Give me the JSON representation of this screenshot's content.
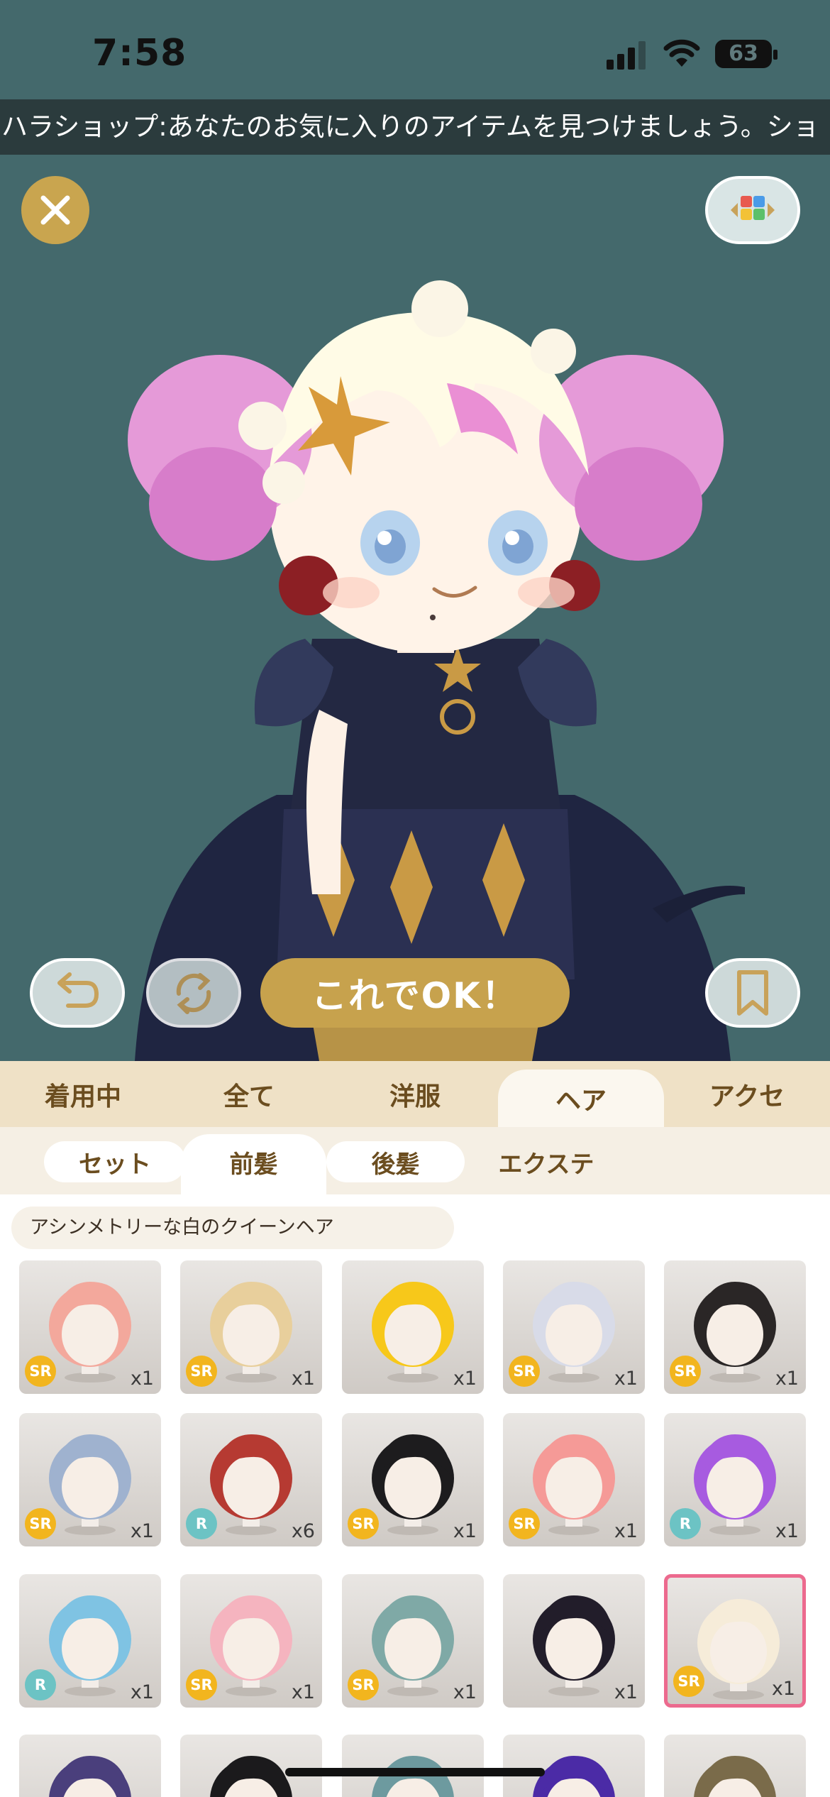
{
  "status": {
    "time": "7:58",
    "battery": "63"
  },
  "ticker": {
    "text": "ハラショップ:あなたのお気に入りのアイテムを見つけましょう。ショ"
  },
  "icons": {
    "close": "close-icon",
    "background": "background-grid-icon",
    "undo": "undo-icon",
    "redo": "redo-icon",
    "bookmark": "bookmark-icon"
  },
  "actions": {
    "ok_label": "これでOK！"
  },
  "category_tabs": [
    {
      "label": "着用中"
    },
    {
      "label": "全て"
    },
    {
      "label": "洋服"
    },
    {
      "label": "ヘア",
      "active": true
    },
    {
      "label": "アクセ"
    }
  ],
  "sub_tabs": [
    {
      "label": "セット"
    },
    {
      "label": "前髪",
      "active": true
    },
    {
      "label": "後髪"
    },
    {
      "label": "エクステ"
    }
  ],
  "selected_item_name": "アシンメトリーな白のクイーンヘア",
  "items": [
    {
      "rarity": "SR",
      "qty": "x1",
      "color": "#f3a89c"
    },
    {
      "rarity": "SR",
      "qty": "x1",
      "color": "#e8cf9c"
    },
    {
      "rarity": "",
      "qty": "x1",
      "color": "#f7c81a"
    },
    {
      "rarity": "SR",
      "qty": "x1",
      "color": "#d8dbe8"
    },
    {
      "rarity": "SR",
      "qty": "x1",
      "color": "#2a2626"
    },
    {
      "rarity": "SR",
      "qty": "x1",
      "color": "#9fb2cf"
    },
    {
      "rarity": "R",
      "qty": "x6",
      "color": "#b63a32"
    },
    {
      "rarity": "SR",
      "qty": "x1",
      "color": "#1d1c1e"
    },
    {
      "rarity": "SR",
      "qty": "x1",
      "color": "#f59a97"
    },
    {
      "rarity": "R",
      "qty": "x1",
      "color": "#a75be0"
    },
    {
      "rarity": "R",
      "qty": "x1",
      "color": "#7fc3e3"
    },
    {
      "rarity": "SR",
      "qty": "x1",
      "color": "#f5b4bf"
    },
    {
      "rarity": "SR",
      "qty": "x1",
      "color": "#7fa9a6"
    },
    {
      "rarity": "",
      "qty": "x1",
      "color": "#221d2a"
    },
    {
      "rarity": "SR",
      "qty": "x1",
      "color": "#f6ecd9",
      "selected": true
    },
    {
      "rarity": "",
      "qty": "",
      "color": "#4a3f7c"
    },
    {
      "rarity": "",
      "qty": "",
      "color": "#1b1a1c"
    },
    {
      "rarity": "",
      "qty": "",
      "color": "#6d9a9f"
    },
    {
      "rarity": "",
      "qty": "",
      "color": "#4b2ba6"
    },
    {
      "rarity": "",
      "qty": "",
      "color": "#7a6b4a"
    }
  ]
}
